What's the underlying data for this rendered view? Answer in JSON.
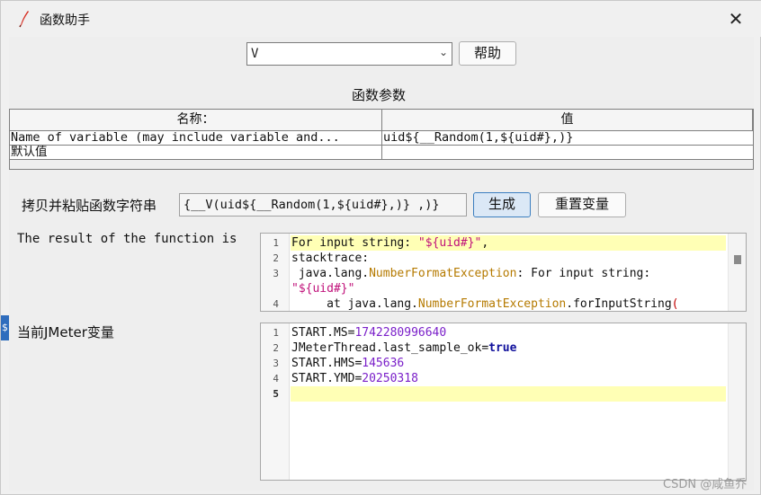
{
  "window": {
    "title": "函数助手",
    "close_glyph": "✕"
  },
  "function_select": {
    "value": "V",
    "chevron": "⌄"
  },
  "buttons": {
    "help": "帮助",
    "generate": "生成",
    "reset_vars": "重置变量"
  },
  "params": {
    "label": "函数参数",
    "headers": [
      "名称：",
      "值"
    ],
    "rows": [
      {
        "name": "Name of variable (may include variable and...",
        "value": "uid${__Random(1,${uid#},)}"
      },
      {
        "name": "默认值",
        "value": ""
      }
    ]
  },
  "copy": {
    "label": "拷贝并粘贴函数字符串",
    "value": "{__V(uid${__Random(1,${uid#},)} ,)}"
  },
  "result": {
    "label": "The result of the function is",
    "line_numbers": [
      "1",
      "2",
      "3",
      "",
      "4"
    ]
  },
  "vars": {
    "label": "当前JMeter变量",
    "line_numbers": [
      "1",
      "2",
      "3",
      "4",
      "5"
    ],
    "lines": [
      {
        "key": "START.MS",
        "eq": "=",
        "val": "1742280996640"
      },
      {
        "key": "JMeterThread.last_sample_ok",
        "eq": "=",
        "val": "true"
      },
      {
        "key": "START.HMS",
        "eq": "=",
        "val": "145636"
      },
      {
        "key": "START.YMD",
        "eq": "=",
        "val": "20250318"
      }
    ]
  },
  "result_code": {
    "l1a": "For input string: ",
    "l1b": "\"${uid#}\"",
    "l1c": ",",
    "l2": "stacktrace:",
    "l3a": " java.lang.",
    "l3b": "NumberFormatException",
    "l3c": ": For input string:",
    "l3d": "\"${uid#}\"",
    "l4a": "     at java.lang.",
    "l4b": "NumberFormatException",
    "l4c": ".forInputString",
    "l4d": "("
  },
  "side_marker": "$",
  "watermark": "CSDN @咸鱼乔"
}
